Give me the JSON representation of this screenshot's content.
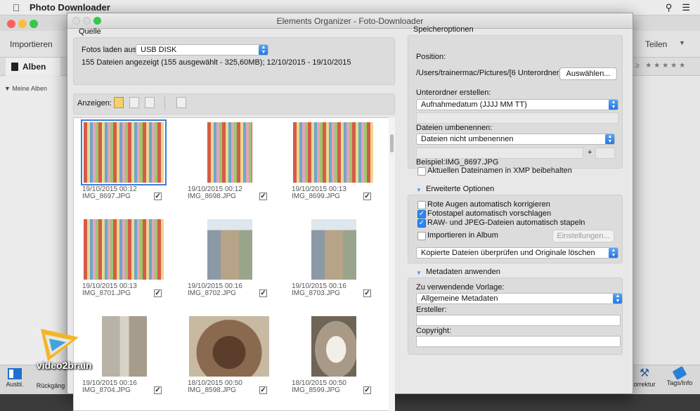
{
  "menubar": {
    "app_name": "Photo Downloader"
  },
  "organizer": {
    "toolbar_left": "Importieren",
    "toolbar_right": "Teilen",
    "tab_alben": "Alben",
    "sidebar_meine_alben": "Meine Alben",
    "rating_stars": "≥ ★★★★★",
    "bottom": {
      "ausbl": "Ausbl.",
      "rueckgaeng": "Rückgäng",
      "korrektur": "orrektur",
      "tags_info": "Tags/Info"
    }
  },
  "dialog": {
    "title": "Elements Organizer - Foto-Downloader",
    "source": {
      "heading": "Quelle",
      "load_from_label": "Fotos laden aus:",
      "load_from_value": "USB DISK",
      "summary": "155 Dateien angezeigt (155 ausgewählt - 325,60MB); 12/10/2015 - 19/10/2015",
      "show_label": "Anzeigen:"
    },
    "thumbnails": [
      {
        "date": "19/10/2015 00:12",
        "name": "IMG_8697.JPG",
        "checked": true,
        "selected": true,
        "scene": "favela"
      },
      {
        "date": "19/10/2015 00:12",
        "name": "IMG_8698.JPG",
        "checked": true,
        "selected": false,
        "scene": "favela"
      },
      {
        "date": "19/10/2015 00:13",
        "name": "IMG_8699.JPG",
        "checked": true,
        "selected": false,
        "scene": "favela"
      },
      {
        "date": "19/10/2015 00:13",
        "name": "IMG_8701.JPG",
        "checked": true,
        "selected": false,
        "scene": "favela"
      },
      {
        "date": "19/10/2015 00:16",
        "name": "IMG_8702.JPG",
        "checked": true,
        "selected": false,
        "scene": "building"
      },
      {
        "date": "19/10/2015 00:16",
        "name": "IMG_8703.JPG",
        "checked": true,
        "selected": false,
        "scene": "building"
      },
      {
        "date": "19/10/2015 00:16",
        "name": "IMG_8704.JPG",
        "checked": true,
        "selected": false,
        "scene": "street"
      },
      {
        "date": "18/10/2015 00:50",
        "name": "IMG_8598.JPG",
        "checked": true,
        "selected": false,
        "scene": "carriage"
      },
      {
        "date": "18/10/2015 00:50",
        "name": "IMG_8599.JPG",
        "checked": true,
        "selected": false,
        "scene": "statue"
      }
    ],
    "storage": {
      "heading": "Speicheroptionen",
      "position_label": "Position:",
      "position_path": "/Users/trainermac/Pictures/[6 Unterordner]",
      "choose_button": "Auswählen...",
      "subfolder_label": "Unterordner erstellen:",
      "subfolder_value": "Aufnahmedatum (JJJJ MM TT)",
      "rename_label": "Dateien umbenennen:",
      "rename_value": "Dateien nicht umbenennen",
      "plus": "+",
      "example": "Beispiel:IMG_8697.JPG",
      "keep_xmp": "Aktuellen Dateinamen in XMP beibehalten",
      "keep_xmp_checked": false
    },
    "advanced": {
      "heading": "Erweiterte Optionen",
      "red_eye": "Rote Augen automatisch korrigieren",
      "red_eye_checked": false,
      "photo_stacks": "Fotostapel automatisch vorschlagen",
      "photo_stacks_checked": true,
      "raw_jpeg": "RAW- und JPEG-Dateien automatisch stapeln",
      "raw_jpeg_checked": true,
      "import_album": "Importieren in Album",
      "import_album_checked": false,
      "settings_button": "Einstellungen...",
      "verify_value": "Kopierte Dateien überprüfen und Originale löschen"
    },
    "metadata": {
      "heading": "Metadaten anwenden",
      "template_label": "Zu verwendende Vorlage:",
      "template_value": "Allgemeine Metadaten",
      "creator_label": "Ersteller:",
      "copyright_label": "Copyright:"
    }
  },
  "watermark": "video2brain",
  "colors": {
    "accent": "#2f86ef",
    "selection": "#3f7bd6"
  }
}
